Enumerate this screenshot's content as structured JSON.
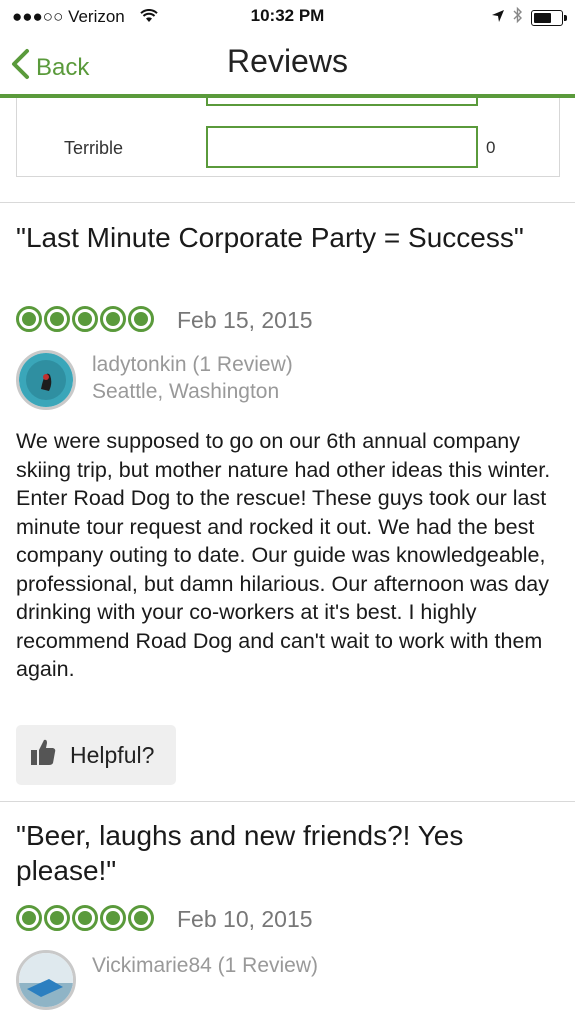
{
  "status": {
    "carrier": "●●●○○ Verizon",
    "time": "10:32 PM"
  },
  "nav": {
    "back_label": "Back",
    "title": "Reviews"
  },
  "rating_row": {
    "label": "Terrible",
    "count": "0"
  },
  "reviews": [
    {
      "title": "\"Last Minute Corporate Party = Success\"",
      "bubbles": 5,
      "date": "Feb 15, 2015",
      "user": "ladytonkin (1 Review)",
      "location": "Seattle, Washington",
      "body": "We were supposed to go on our 6th annual company skiing trip, but mother nature had other ideas this winter. Enter Road Dog to the rescue! These guys took our last minute tour request and rocked it out. We had the best company outing to date. Our guide was knowledgeable, professional, but damn hilarious. Our afternoon was day drinking with your co-workers at it's best. I highly recommend Road Dog and can't wait to work with them again.",
      "helpful_label": "Helpful?"
    },
    {
      "title": "\"Beer, laughs and new friends?! Yes please!\"",
      "bubbles": 5,
      "date": "Feb 10, 2015",
      "user": "Vickimarie84  (1 Review)"
    }
  ],
  "colors": {
    "accent": "#5a9a3b"
  }
}
